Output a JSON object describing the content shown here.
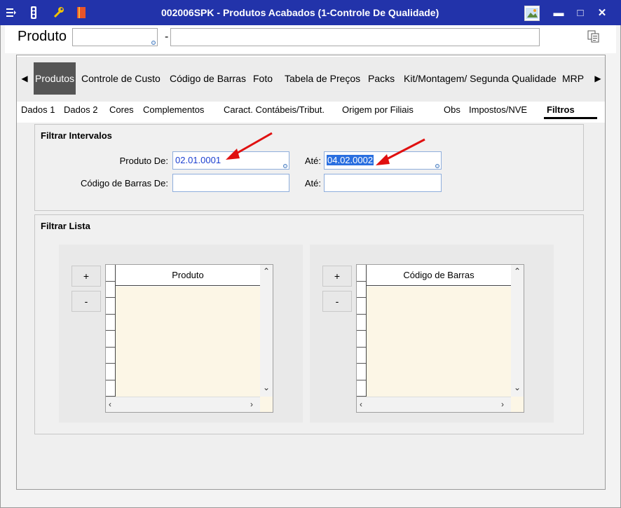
{
  "window": {
    "title": "002006SPK - Produtos Acabados (1-Controle De Qualidade)",
    "controls": {
      "minimize": "▬",
      "maximize": "□",
      "close": "✕"
    }
  },
  "header": {
    "product_label": "Produto",
    "product_code_value": "",
    "separator": "-",
    "product_desc_value": ""
  },
  "tabs": {
    "items": [
      {
        "label": "Produtos"
      },
      {
        "label": "Controle de Custo"
      },
      {
        "label": "Código de Barras"
      },
      {
        "label": "Foto"
      },
      {
        "label": "Tabela de Preços"
      },
      {
        "label": "Packs"
      },
      {
        "label": "Kit/Montagem/ Segunda Qualidade"
      },
      {
        "label": "MRP"
      }
    ]
  },
  "subtabs": {
    "items": [
      {
        "label": "Dados 1"
      },
      {
        "label": "Dados 2"
      },
      {
        "label": "Cores"
      },
      {
        "label": "Complementos"
      },
      {
        "label": "Caract. Contábeis/Tribut."
      },
      {
        "label": "Origem por Filiais"
      },
      {
        "label": "Obs"
      },
      {
        "label": "Impostos/NVE"
      },
      {
        "label": "Filtros"
      }
    ]
  },
  "filtrar_intervalos": {
    "title": "Filtrar Intervalos",
    "produto_de_label": "Produto De:",
    "produto_de_value": "02.01.0001",
    "ate_label_1": "Até:",
    "produto_ate_value": "04.02.0002",
    "codbarras_de_label": "Código de Barras De:",
    "codbarras_de_value": "",
    "ate_label_2": "Até:",
    "codbarras_ate_value": ""
  },
  "filtrar_lista": {
    "title": "Filtrar Lista",
    "add_label": "+",
    "remove_label": "-",
    "grid_produto_header": "Produto",
    "grid_codbarras_header": "Código de Barras"
  },
  "colors": {
    "titlebar": "#2233aa",
    "active_tab": "#555555",
    "grid_body": "#fcf6e6",
    "selection": "#2a6fe0",
    "annotation_arrow": "#e01010"
  }
}
